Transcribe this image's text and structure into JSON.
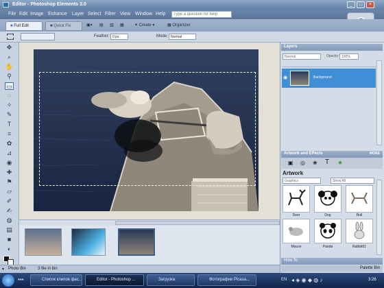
{
  "window": {
    "title": "Editor - Photoshop Elements 3.0"
  },
  "menu": [
    "File",
    "Edit",
    "Image",
    "Enhance",
    "Layer",
    "Select",
    "Filter",
    "View",
    "Window",
    "Help"
  ],
  "help_search": {
    "placeholder": "Type a question for help"
  },
  "shortcuts": {
    "tab_fulledit": "Full Edit",
    "tab_quickfix": "Quick Fix",
    "create": "Create",
    "organizer": "Organizer"
  },
  "options": {
    "feather_label": "Feather:",
    "feather_value": "0 px",
    "mode_label": "Mode:",
    "mode_value": "Normal"
  },
  "status": {
    "zoom": "",
    "size": ""
  },
  "photo_bin": {
    "thumbs": [
      {
        "caption": ""
      },
      {
        "caption": ""
      },
      {
        "caption": ""
      }
    ],
    "label": "Photo Bin",
    "files_label": "3 file in bin"
  },
  "layers": {
    "title": "Layers",
    "blend_mode": "Normal",
    "opacity_label": "Opacity:",
    "opacity_value": "100%",
    "layer_name": "Background"
  },
  "artwork": {
    "title": "Artwork and Effects",
    "section": "Artwork",
    "category": "Graphics",
    "filter": "Show All",
    "items": [
      {
        "label": "Deer",
        "icon": "deer-icon"
      },
      {
        "label": "Dog",
        "icon": "dog-icon"
      },
      {
        "label": "Bull",
        "icon": "bull-icon"
      },
      {
        "label": "Mouse",
        "icon": "mouse-icon"
      },
      {
        "label": "Panda",
        "icon": "panda-icon"
      },
      {
        "label": "Rabbit01",
        "icon": "rabbit-icon"
      }
    ],
    "more": "MORE"
  },
  "bottom_panels": {
    "palette_bin": "Palette Bin",
    "how_to": "How To"
  },
  "taskbar": {
    "items": [
      {
        "label": "Список клипов фас..."
      },
      {
        "label": "Editor - Photoshop ..."
      },
      {
        "label": "Загрузка"
      },
      {
        "label": "Фотографии Picasa..."
      }
    ],
    "lang": "EN",
    "clock": "3:26"
  },
  "colors": {
    "accent": "#3f8ed6",
    "title": "#6a86ad"
  }
}
